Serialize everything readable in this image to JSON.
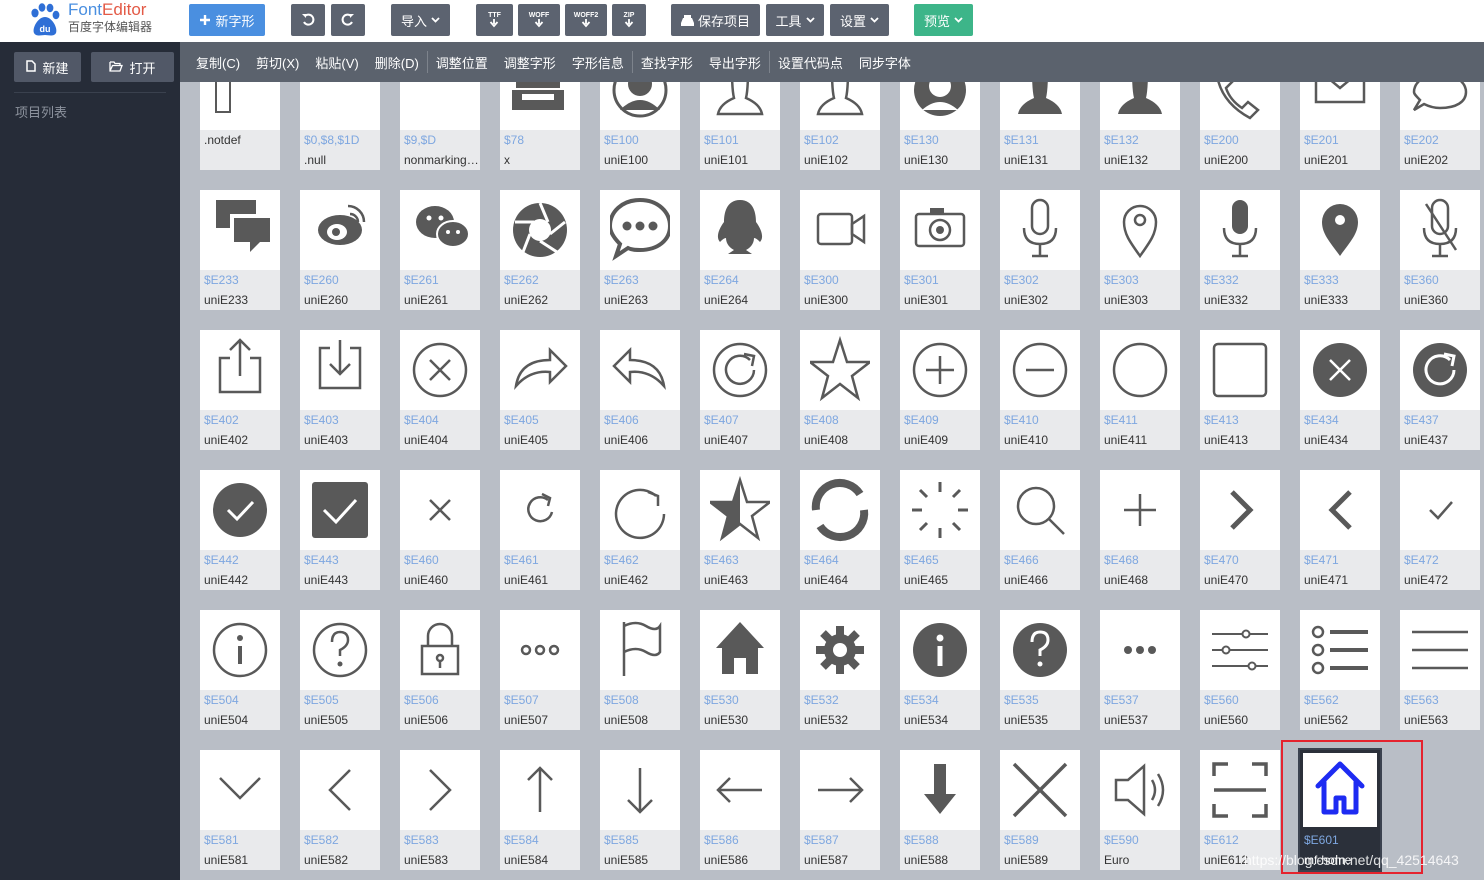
{
  "app": {
    "logo_title_a": "Font",
    "logo_title_b": "Editor",
    "logo_subtitle": "百度字体编辑器"
  },
  "toolbar": {
    "new_glyph": "新字形",
    "import": "导入",
    "export_ttf": "TTF",
    "export_woff": "WOFF",
    "export_woff2": "WOFF2",
    "export_zip": "ZIP",
    "save_project": "保存项目",
    "tools": "工具",
    "settings": "设置",
    "preview": "预览"
  },
  "sidebar": {
    "new": "新建",
    "open": "打开",
    "project_list": "项目列表"
  },
  "editbar": [
    "复制(C)",
    "剪切(X)",
    "粘贴(V)",
    "删除(D)",
    "调整位置",
    "调整字形",
    "字形信息",
    "查找字形",
    "导出字形",
    "设置代码点",
    "同步字体"
  ],
  "glyphs": [
    [
      {
        "code": "",
        "name": ".notdef",
        "icon": "notdef-box"
      },
      {
        "code": "$0,$8,$1D",
        "name": ".null",
        "icon": "empty"
      },
      {
        "code": "$9,$D",
        "name": "nonmarkingreturn",
        "icon": "empty"
      },
      {
        "code": "$78",
        "name": "x",
        "icon": "printer"
      },
      {
        "code": "$E100",
        "name": "uniE100",
        "icon": "user-avatar"
      },
      {
        "code": "$E101",
        "name": "uniE101",
        "icon": "user-outline"
      },
      {
        "code": "$E102",
        "name": "uniE102",
        "icon": "user-outline"
      },
      {
        "code": "$E130",
        "name": "uniE130",
        "icon": "user-avatar-filled"
      },
      {
        "code": "$E131",
        "name": "uniE131",
        "icon": "user-filled"
      },
      {
        "code": "$E132",
        "name": "uniE132",
        "icon": "user-filled"
      },
      {
        "code": "$E200",
        "name": "uniE200",
        "icon": "phone"
      },
      {
        "code": "$E201",
        "name": "uniE201",
        "icon": "mail"
      },
      {
        "code": "$E202",
        "name": "uniE202",
        "icon": "chat-bubble"
      }
    ],
    [
      {
        "code": "$E233",
        "name": "uniE233",
        "icon": "chat-bubbles"
      },
      {
        "code": "$E260",
        "name": "uniE260",
        "icon": "weibo"
      },
      {
        "code": "$E261",
        "name": "uniE261",
        "icon": "wechat"
      },
      {
        "code": "$E262",
        "name": "uniE262",
        "icon": "aperture"
      },
      {
        "code": "$E263",
        "name": "uniE263",
        "icon": "message-dots"
      },
      {
        "code": "$E264",
        "name": "uniE264",
        "icon": "qq"
      },
      {
        "code": "$E300",
        "name": "uniE300",
        "icon": "video"
      },
      {
        "code": "$E301",
        "name": "uniE301",
        "icon": "camera"
      },
      {
        "code": "$E302",
        "name": "uniE302",
        "icon": "microphone"
      },
      {
        "code": "$E303",
        "name": "uniE303",
        "icon": "map-pin"
      },
      {
        "code": "$E332",
        "name": "uniE332",
        "icon": "microphone-filled"
      },
      {
        "code": "$E333",
        "name": "uniE333",
        "icon": "map-pin-filled"
      },
      {
        "code": "$E360",
        "name": "uniE360",
        "icon": "microphone-off"
      }
    ],
    [
      {
        "code": "$E402",
        "name": "uniE402",
        "icon": "share-up"
      },
      {
        "code": "$E403",
        "name": "uniE403",
        "icon": "download-tray"
      },
      {
        "code": "$E404",
        "name": "uniE404",
        "icon": "circle-close"
      },
      {
        "code": "$E405",
        "name": "uniE405",
        "icon": "share-forward"
      },
      {
        "code": "$E406",
        "name": "uniE406",
        "icon": "reply"
      },
      {
        "code": "$E407",
        "name": "uniE407",
        "icon": "circle-refresh"
      },
      {
        "code": "$E408",
        "name": "uniE408",
        "icon": "star"
      },
      {
        "code": "$E409",
        "name": "uniE409",
        "icon": "circle-plus"
      },
      {
        "code": "$E410",
        "name": "uniE410",
        "icon": "circle-minus"
      },
      {
        "code": "$E411",
        "name": "uniE411",
        "icon": "circle"
      },
      {
        "code": "$E413",
        "name": "uniE413",
        "icon": "square"
      },
      {
        "code": "$E434",
        "name": "uniE434",
        "icon": "circle-close-filled"
      },
      {
        "code": "$E437",
        "name": "uniE437",
        "icon": "circle-refresh-filled"
      }
    ],
    [
      {
        "code": "$E442",
        "name": "uniE442",
        "icon": "check-circle-filled"
      },
      {
        "code": "$E443",
        "name": "uniE443",
        "icon": "check-square-filled"
      },
      {
        "code": "$E460",
        "name": "uniE460",
        "icon": "close"
      },
      {
        "code": "$E461",
        "name": "uniE461",
        "icon": "refresh"
      },
      {
        "code": "$E462",
        "name": "uniE462",
        "icon": "refresh-large"
      },
      {
        "code": "$E463",
        "name": "uniE463",
        "icon": "star-half"
      },
      {
        "code": "$E464",
        "name": "uniE464",
        "icon": "loading-ring"
      },
      {
        "code": "$E465",
        "name": "uniE465",
        "icon": "spinner"
      },
      {
        "code": "$E466",
        "name": "uniE466",
        "icon": "search"
      },
      {
        "code": "$E468",
        "name": "uniE468",
        "icon": "plus"
      },
      {
        "code": "$E470",
        "name": "uniE470",
        "icon": "chevron-right-bold"
      },
      {
        "code": "$E471",
        "name": "uniE471",
        "icon": "chevron-left-bold"
      },
      {
        "code": "$E472",
        "name": "uniE472",
        "icon": "check"
      }
    ],
    [
      {
        "code": "$E504",
        "name": "uniE504",
        "icon": "info-circle"
      },
      {
        "code": "$E505",
        "name": "uniE505",
        "icon": "question-circle"
      },
      {
        "code": "$E506",
        "name": "uniE506",
        "icon": "lock"
      },
      {
        "code": "$E507",
        "name": "uniE507",
        "icon": "dots-outline"
      },
      {
        "code": "$E508",
        "name": "uniE508",
        "icon": "flag"
      },
      {
        "code": "$E530",
        "name": "uniE530",
        "icon": "home-filled"
      },
      {
        "code": "$E532",
        "name": "uniE532",
        "icon": "gear"
      },
      {
        "code": "$E534",
        "name": "uniE534",
        "icon": "info-circle-filled"
      },
      {
        "code": "$E535",
        "name": "uniE535",
        "icon": "question-circle-filled"
      },
      {
        "code": "$E537",
        "name": "uniE537",
        "icon": "dots-filled"
      },
      {
        "code": "$E560",
        "name": "uniE560",
        "icon": "sliders"
      },
      {
        "code": "$E562",
        "name": "uniE562",
        "icon": "list"
      },
      {
        "code": "$E563",
        "name": "uniE563",
        "icon": "menu"
      }
    ],
    [
      {
        "code": "$E581",
        "name": "uniE581",
        "icon": "chevron-down"
      },
      {
        "code": "$E582",
        "name": "uniE582",
        "icon": "chevron-left"
      },
      {
        "code": "$E583",
        "name": "uniE583",
        "icon": "chevron-right"
      },
      {
        "code": "$E584",
        "name": "uniE584",
        "icon": "arrow-up"
      },
      {
        "code": "$E585",
        "name": "uniE585",
        "icon": "arrow-down"
      },
      {
        "code": "$E586",
        "name": "uniE586",
        "icon": "arrow-left"
      },
      {
        "code": "$E587",
        "name": "uniE587",
        "icon": "arrow-right"
      },
      {
        "code": "$E588",
        "name": "uniE588",
        "icon": "arrow-down-bold"
      },
      {
        "code": "$E589",
        "name": "uniE589",
        "icon": "close-large"
      },
      {
        "code": "$E590",
        "name": "Euro",
        "icon": "speaker"
      },
      {
        "code": "$E612",
        "name": "uniE612",
        "icon": "scan"
      },
      {
        "code": "$E601",
        "name": "mf-home",
        "icon": "home-outline",
        "selected": true
      }
    ]
  ],
  "watermark": "https://blog.csdn.net/qq_42514643",
  "colors": {
    "glyph": "#595959",
    "selected_glyph": "#1d2bf2",
    "highlight": "#e5232e",
    "code_text": "#7ea7e0"
  }
}
